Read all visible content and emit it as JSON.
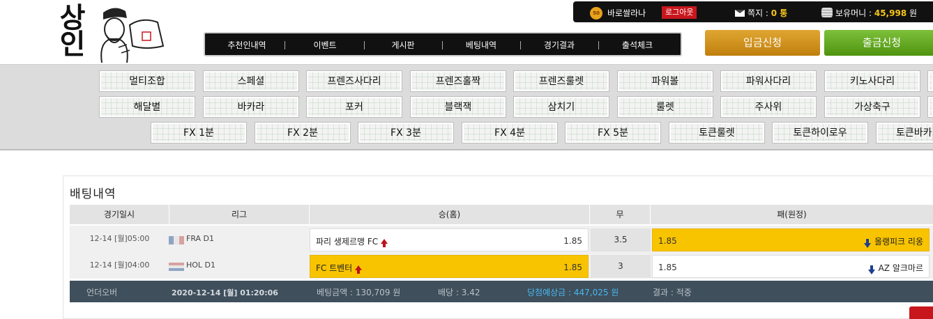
{
  "logo": {
    "text": "상인"
  },
  "userbar": {
    "coin_icon": "coin-icon",
    "username": "바로쌀라나",
    "logout_label": "로그아웃",
    "message_label": "쪽지 :",
    "message_count": "0 통",
    "cash_label": "보유머니 :",
    "cash_amount": "45,998",
    "cash_unit": "원"
  },
  "nav": {
    "items": [
      {
        "label": "추천인내역"
      },
      {
        "label": "이벤트"
      },
      {
        "label": "게시판"
      },
      {
        "label": "베팅내역"
      },
      {
        "label": "경기결과"
      },
      {
        "label": "출석체크"
      }
    ]
  },
  "actions": {
    "deposit_label": "입금신청",
    "withdraw_label": "출금신청"
  },
  "game_menu": {
    "row1": [
      "멀티조합",
      "스페셜",
      "프렌즈사다리",
      "프렌즈홀짝",
      "프렌즈룰렛",
      "파워볼",
      "파워사다리",
      "키노사다리"
    ],
    "row2": [
      "해달별",
      "바카라",
      "포커",
      "블랙잭",
      "삼치기",
      "룰렛",
      "주사위",
      "가상축구"
    ],
    "row3": [
      "FX 1분",
      "FX 2분",
      "FX 3분",
      "FX 4분",
      "FX 5분",
      "토큰룰렛",
      "토큰하이로우",
      "토큰바카"
    ]
  },
  "bets": {
    "title": "배팅내역",
    "columns": [
      "경기일시",
      "리그",
      "승(홈)",
      "무",
      "패(원정)"
    ],
    "rows": [
      {
        "datetime": "12-14 [월]05:00",
        "league": "FRA D1",
        "home": "파리 생제르맹 FC",
        "home_odds": "1.85",
        "draw_odds": "3.5",
        "away": "올랭피크 리옹",
        "away_odds": "1.85",
        "selected": "away"
      },
      {
        "datetime": "12-14 [월]04:00",
        "league": "HOL D1",
        "home": "FC 트벤터",
        "home_odds": "1.85",
        "draw_odds": "3",
        "away": "AZ 알크마르",
        "away_odds": "1.85",
        "selected": "home"
      }
    ],
    "summary": {
      "type": "언더오버",
      "datetime": "2020-12-14 [월] 01:20:06",
      "amount": "베팅금액 : 130,709 원",
      "odds": "배당 : 3.42",
      "expected": "당첨예상금 : 447,025 원",
      "result": "결과 : 적중"
    }
  },
  "colors": {
    "selected": "#f8c400",
    "deposit": "#d4961f",
    "withdraw": "#62a825",
    "accent_red": "#c8161d"
  }
}
